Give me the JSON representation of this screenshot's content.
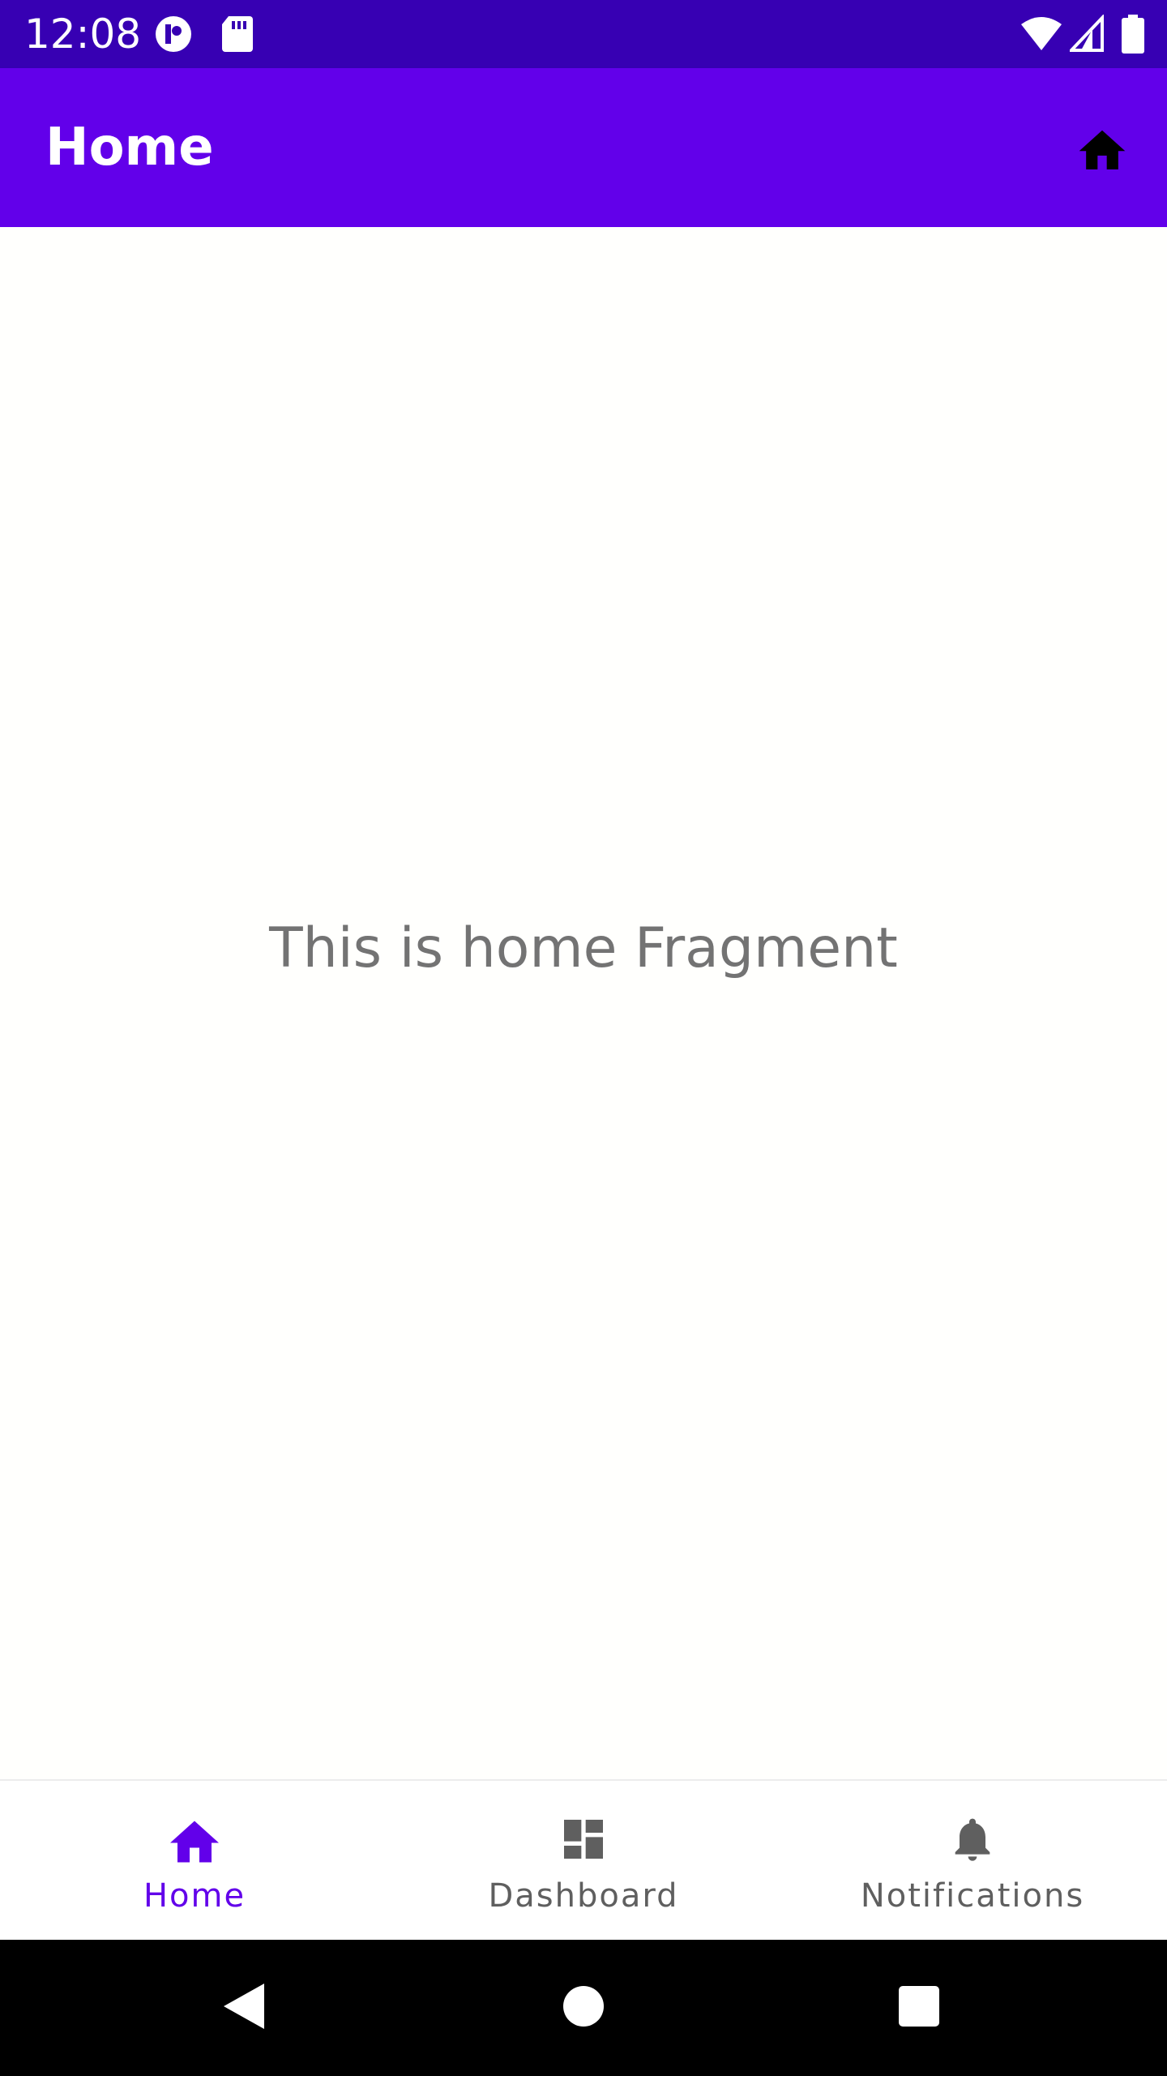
{
  "status_bar": {
    "time": "12:08",
    "background": "#3700b3",
    "left_icons": [
      "app-notification-icon",
      "sd-card-icon"
    ],
    "right_icons": [
      "wifi-icon",
      "cellular-signal-icon",
      "battery-icon"
    ]
  },
  "app_bar": {
    "title": "Home",
    "background": "#6200ea",
    "action_icon": "home-icon"
  },
  "content": {
    "message": "This is home Fragment"
  },
  "bottom_nav": {
    "accent": "#6200ea",
    "inactive": "#5f5f5f",
    "items": [
      {
        "label": "Home",
        "icon": "home-icon",
        "selected": true
      },
      {
        "label": "Dashboard",
        "icon": "dashboard-icon",
        "selected": false
      },
      {
        "label": "Notifications",
        "icon": "bell-icon",
        "selected": false
      }
    ]
  },
  "system_nav": {
    "buttons": [
      "back-icon",
      "home-circle-icon",
      "recents-icon"
    ]
  }
}
